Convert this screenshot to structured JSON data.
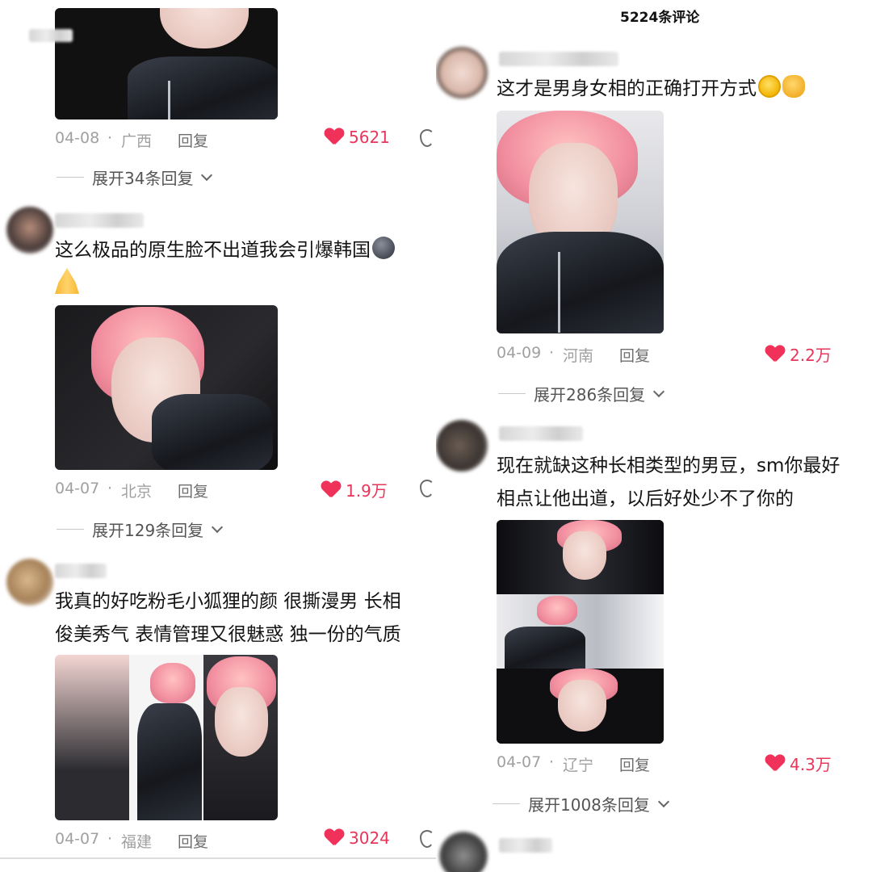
{
  "header": {
    "comment_count": "5224条评论"
  },
  "left": {
    "comment_1": {
      "date": "04-08",
      "location": "广西",
      "reply": "回复",
      "likes": "5621",
      "expand": "展开34条回复"
    },
    "comment_2": {
      "text_line1": "这么极品的原生脸不出道我会引爆韩国",
      "emoji_1": "gloomy-face-emoji",
      "emoji_2": "folded-hands-emoji",
      "date": "04-07",
      "location": "北京",
      "reply": "回复",
      "likes": "1.9万",
      "expand": "展开129条回复"
    },
    "comment_3": {
      "text_line1": "我真的好吃粉毛小狐狸的颜 很撕漫男 长相",
      "text_line2": "俊美秀气 表情管理又很魅惑 独一份的气质",
      "date": "04-07",
      "location": "福建",
      "reply": "回复",
      "likes": "3024"
    }
  },
  "right": {
    "comment_1": {
      "text_line1": "这才是男身女相的正确打开方式",
      "emoji_1": "rofl-emoji",
      "emoji_2": "ok-hand-emoji",
      "date": "04-09",
      "location": "河南",
      "reply": "回复",
      "likes": "2.2万",
      "expand": "展开286条回复"
    },
    "comment_2": {
      "text_line1": "现在就缺这种长相类型的男豆，sm你最好",
      "text_line2": "相点让他出道，以后好处少不了你的",
      "date": "04-07",
      "location": "辽宁",
      "reply": "回复",
      "likes": "4.3万",
      "expand": "展开1008条回复"
    }
  },
  "meta_separator": "·",
  "colors": {
    "like_red": "#f0325a",
    "meta_gray": "#a0a0a0",
    "text": "#141414"
  }
}
